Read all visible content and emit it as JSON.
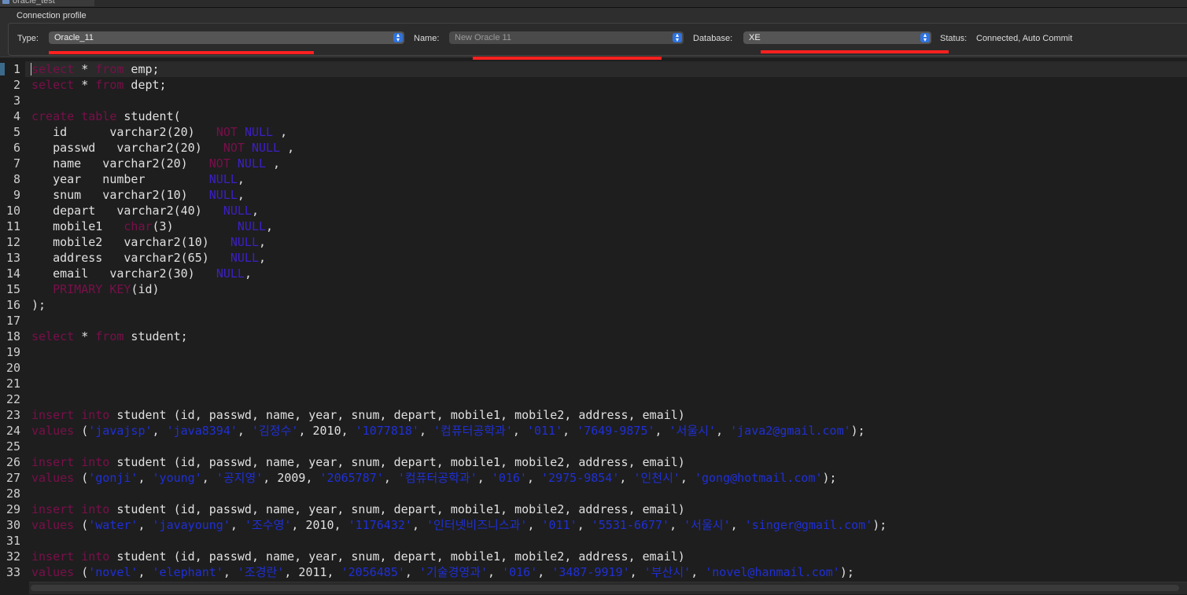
{
  "tab": {
    "label": "oracle_test"
  },
  "connection_profile": {
    "title": "Connection profile",
    "type_label": "Type:",
    "type_value": "Oracle_11",
    "name_label": "Name:",
    "name_value": "New Oracle 11",
    "database_label": "Database:",
    "database_value": "XE",
    "status_label": "Status:",
    "status_value": "Connected, Auto Commit"
  },
  "colors": {
    "keyword": "#7a0f4a",
    "null_keyword": "#3d1fc8",
    "string": "#1f2fd6",
    "annotation": "#ff2020",
    "selector_accent": "#2f73e0"
  },
  "editor": {
    "lines": [
      [
        [
          "k",
          "select"
        ],
        [
          "p",
          " * "
        ],
        [
          "k",
          "from"
        ],
        [
          "p",
          " emp;"
        ]
      ],
      [
        [
          "k",
          "select"
        ],
        [
          "p",
          " * "
        ],
        [
          "k",
          "from"
        ],
        [
          "p",
          " dept;"
        ]
      ],
      [],
      [
        [
          "k",
          "create table"
        ],
        [
          "p",
          " student("
        ]
      ],
      [
        [
          "p",
          "   id      varchar2(20)   "
        ],
        [
          "k",
          "NOT"
        ],
        [
          "p",
          " "
        ],
        [
          "n",
          "NULL"
        ],
        [
          "p",
          " ,"
        ]
      ],
      [
        [
          "p",
          "   passwd   varchar2(20)   "
        ],
        [
          "k",
          "NOT"
        ],
        [
          "p",
          " "
        ],
        [
          "n",
          "NULL"
        ],
        [
          "p",
          " ,"
        ]
      ],
      [
        [
          "p",
          "   name   varchar2(20)   "
        ],
        [
          "k",
          "NOT"
        ],
        [
          "p",
          " "
        ],
        [
          "n",
          "NULL"
        ],
        [
          "p",
          " ,"
        ]
      ],
      [
        [
          "p",
          "   year   number         "
        ],
        [
          "n",
          "NULL"
        ],
        [
          "p",
          ","
        ]
      ],
      [
        [
          "p",
          "   snum   varchar2(10)   "
        ],
        [
          "n",
          "NULL"
        ],
        [
          "p",
          ","
        ]
      ],
      [
        [
          "p",
          "   depart   varchar2(40)   "
        ],
        [
          "n",
          "NULL"
        ],
        [
          "p",
          ","
        ]
      ],
      [
        [
          "p",
          "   mobile1   "
        ],
        [
          "k",
          "char"
        ],
        [
          "p",
          "(3)         "
        ],
        [
          "n",
          "NULL"
        ],
        [
          "p",
          ","
        ]
      ],
      [
        [
          "p",
          "   mobile2   varchar2(10)   "
        ],
        [
          "n",
          "NULL"
        ],
        [
          "p",
          ","
        ]
      ],
      [
        [
          "p",
          "   address   varchar2(65)   "
        ],
        [
          "n",
          "NULL"
        ],
        [
          "p",
          ","
        ]
      ],
      [
        [
          "p",
          "   email   varchar2(30)   "
        ],
        [
          "n",
          "NULL"
        ],
        [
          "p",
          ","
        ]
      ],
      [
        [
          "p",
          "   "
        ],
        [
          "k",
          "PRIMARY KEY"
        ],
        [
          "p",
          "(id)"
        ]
      ],
      [
        [
          "p",
          ");"
        ]
      ],
      [],
      [
        [
          "k",
          "select"
        ],
        [
          "p",
          " * "
        ],
        [
          "k",
          "from"
        ],
        [
          "p",
          " student;"
        ]
      ],
      [],
      [],
      [],
      [],
      [
        [
          "k",
          "insert into"
        ],
        [
          "p",
          " student (id, passwd, name, year, snum, depart, mobile1, mobile2, address, email)"
        ]
      ],
      [
        [
          "k",
          "values"
        ],
        [
          "p",
          " ("
        ],
        [
          "s",
          "'javajsp'"
        ],
        [
          "p",
          ", "
        ],
        [
          "s",
          "'java8394'"
        ],
        [
          "p",
          ", "
        ],
        [
          "s",
          "'김정수'"
        ],
        [
          "p",
          ", 2010, "
        ],
        [
          "s",
          "'1077818'"
        ],
        [
          "p",
          ", "
        ],
        [
          "s",
          "'컴퓨터공학과'"
        ],
        [
          "p",
          ", "
        ],
        [
          "s",
          "'011'"
        ],
        [
          "p",
          ", "
        ],
        [
          "s",
          "'7649-9875'"
        ],
        [
          "p",
          ", "
        ],
        [
          "s",
          "'서울시'"
        ],
        [
          "p",
          ", "
        ],
        [
          "s",
          "'java2@gmail.com'"
        ],
        [
          "p",
          ");"
        ]
      ],
      [],
      [
        [
          "k",
          "insert into"
        ],
        [
          "p",
          " student (id, passwd, name, year, snum, depart, mobile1, mobile2, address, email)"
        ]
      ],
      [
        [
          "k",
          "values"
        ],
        [
          "p",
          " ("
        ],
        [
          "s",
          "'gonji'"
        ],
        [
          "p",
          ", "
        ],
        [
          "s",
          "'young'"
        ],
        [
          "p",
          ", "
        ],
        [
          "s",
          "'공지영'"
        ],
        [
          "p",
          ", 2009, "
        ],
        [
          "s",
          "'2065787'"
        ],
        [
          "p",
          ", "
        ],
        [
          "s",
          "'컴퓨터공학과'"
        ],
        [
          "p",
          ", "
        ],
        [
          "s",
          "'016'"
        ],
        [
          "p",
          ", "
        ],
        [
          "s",
          "'2975-9854'"
        ],
        [
          "p",
          ", "
        ],
        [
          "s",
          "'인천시'"
        ],
        [
          "p",
          ", "
        ],
        [
          "s",
          "'gong@hotmail.com'"
        ],
        [
          "p",
          ");"
        ]
      ],
      [],
      [
        [
          "k",
          "insert into"
        ],
        [
          "p",
          " student (id, passwd, name, year, snum, depart, mobile1, mobile2, address, email)"
        ]
      ],
      [
        [
          "k",
          "values"
        ],
        [
          "p",
          " ("
        ],
        [
          "s",
          "'water'"
        ],
        [
          "p",
          ", "
        ],
        [
          "s",
          "'javayoung'"
        ],
        [
          "p",
          ", "
        ],
        [
          "s",
          "'조수영'"
        ],
        [
          "p",
          ", 2010, "
        ],
        [
          "s",
          "'1176432'"
        ],
        [
          "p",
          ", "
        ],
        [
          "s",
          "'인터넷비즈니스과'"
        ],
        [
          "p",
          ", "
        ],
        [
          "s",
          "'011'"
        ],
        [
          "p",
          ", "
        ],
        [
          "s",
          "'5531-6677'"
        ],
        [
          "p",
          ", "
        ],
        [
          "s",
          "'서울시'"
        ],
        [
          "p",
          ", "
        ],
        [
          "s",
          "'singer@gmail.com'"
        ],
        [
          "p",
          ");"
        ]
      ],
      [],
      [
        [
          "k",
          "insert into"
        ],
        [
          "p",
          " student (id, passwd, name, year, snum, depart, mobile1, mobile2, address, email)"
        ]
      ],
      [
        [
          "k",
          "values"
        ],
        [
          "p",
          " ("
        ],
        [
          "s",
          "'novel'"
        ],
        [
          "p",
          ", "
        ],
        [
          "s",
          "'elephant'"
        ],
        [
          "p",
          ", "
        ],
        [
          "s",
          "'조경란'"
        ],
        [
          "p",
          ", 2011, "
        ],
        [
          "s",
          "'2056485'"
        ],
        [
          "p",
          ", "
        ],
        [
          "s",
          "'기술경영과'"
        ],
        [
          "p",
          ", "
        ],
        [
          "s",
          "'016'"
        ],
        [
          "p",
          ", "
        ],
        [
          "s",
          "'3487-9919'"
        ],
        [
          "p",
          ", "
        ],
        [
          "s",
          "'부산시'"
        ],
        [
          "p",
          ", "
        ],
        [
          "s",
          "'novel@hanmail.com'"
        ],
        [
          "p",
          ");"
        ]
      ]
    ]
  }
}
